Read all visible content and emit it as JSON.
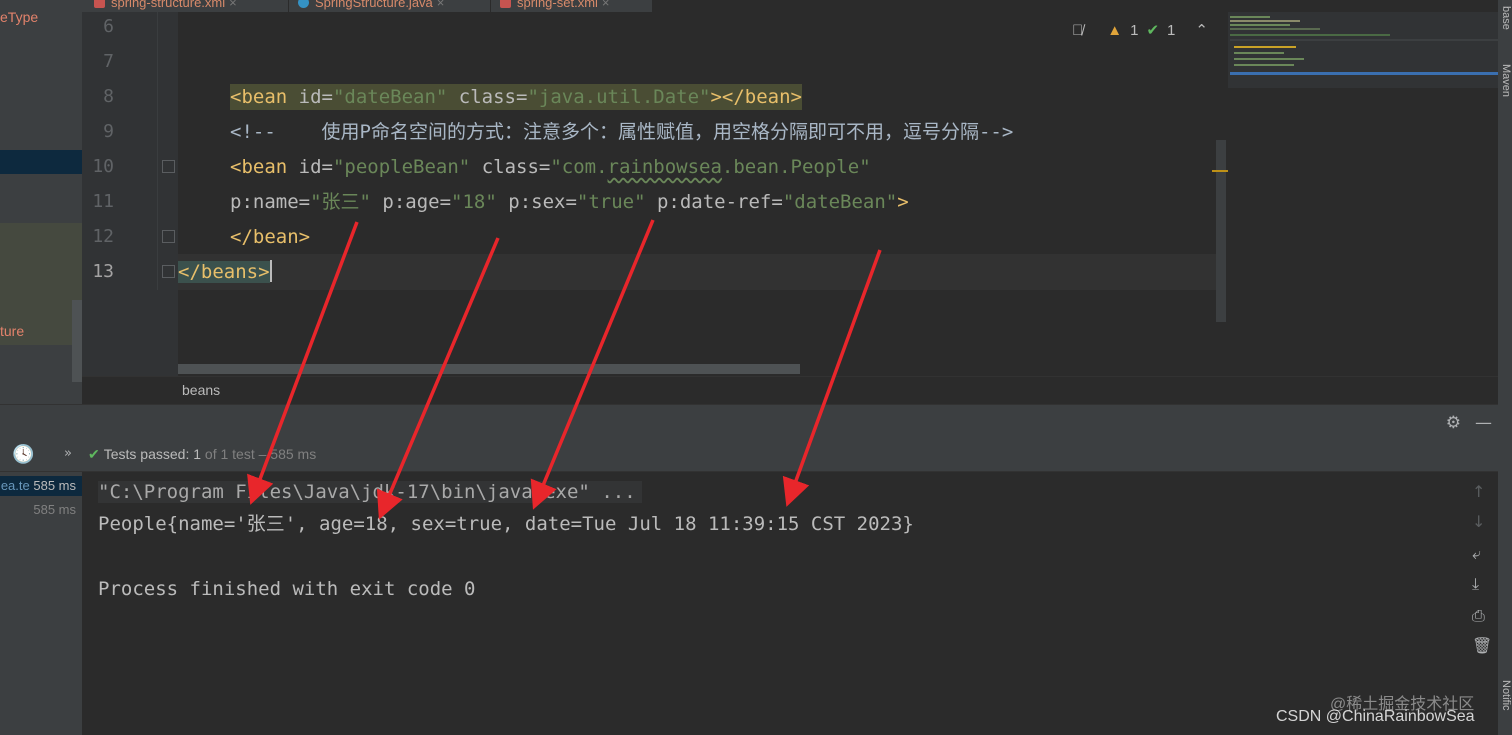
{
  "tabs": [
    {
      "label": "spring-structure.xml"
    },
    {
      "label": "SpringStructure.java"
    },
    {
      "label": "spring-set.xml"
    }
  ],
  "project_panel": {
    "item_top": "eType",
    "item_bottom": "ture"
  },
  "editor": {
    "line_numbers": [
      "6",
      "7",
      "8",
      "9",
      "10",
      "11",
      "12",
      "13"
    ],
    "line8": {
      "open": "<bean ",
      "id_attr": "id=",
      "id_val": "\"dateBean\"",
      "class_attr": " class=",
      "class_val": "\"java.util.Date\"",
      "close": "></bean>"
    },
    "line9": "<!--    使用P命名空间的方式：注意多个：属性赋值，用空格分隔即可不用，逗号分隔-->",
    "line10": {
      "open": "<bean ",
      "id_attr": "id=",
      "id_val": "\"peopleBean\"",
      "class_attr": " class=",
      "class_val_pre": "\"com.",
      "class_val_squig": "rainbowsea",
      "class_val_post": ".bean.People\""
    },
    "line11": {
      "a1": "p:name=",
      "v1": "\"张三\"",
      "a2": " p:age=",
      "v2": "\"18\"",
      "a3": " p:sex=",
      "v3": "\"true\"",
      "a4": " p:date-ref=",
      "v4": "\"dateBean\"",
      "end": ">"
    },
    "line12": "</bean>",
    "line13": "</beans>",
    "inspections": {
      "warnings": "1",
      "ok": "1"
    }
  },
  "breadcrumb": "beans",
  "run": {
    "tests_label": "Tests passed:",
    "tests_count": "1",
    "tests_of": "of 1 test – 585 ms",
    "tree": [
      {
        "name": "ea.te",
        "time": "585 ms"
      },
      {
        "name": "",
        "time": "585 ms"
      }
    ],
    "console": [
      "\"C:\\Program Files\\Java\\jdk-17\\bin\\java.exe\" ...",
      "People{name='张三', age=18, sex=true, date=Tue Jul 18 11:39:15 CST 2023}",
      "Process finished with exit code 0"
    ]
  },
  "side_labels": {
    "top": "base",
    "middle": "Maven",
    "bottom": "Notific"
  },
  "watermark": {
    "line1": "@稀土掘金技术社区",
    "line2": "CSDN @ChinaRainbowSea"
  },
  "colors": {
    "background": "#2b2b2b",
    "tag": "#e8bf6a",
    "string": "#6a8759",
    "annotation_arrow": "#e8262b"
  }
}
